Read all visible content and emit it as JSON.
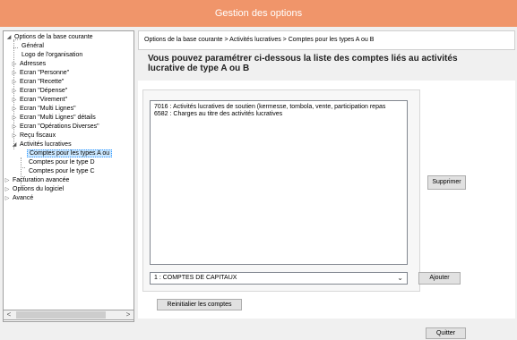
{
  "window": {
    "title": "Gestion des options"
  },
  "tree": {
    "items": [
      {
        "label": "Options de la base courante",
        "exp": "◢"
      },
      {
        "label": "Général",
        "exp": ""
      },
      {
        "label": "Logo de l'organisation",
        "exp": ""
      },
      {
        "label": "Adresses",
        "exp": "▷"
      },
      {
        "label": "Ecran \"Personne\"",
        "exp": "▷"
      },
      {
        "label": "Ecran \"Recette\"",
        "exp": "▷"
      },
      {
        "label": "Ecran \"Dépense\"",
        "exp": "▷"
      },
      {
        "label": "Ecran \"Virement\"",
        "exp": "▷"
      },
      {
        "label": "Ecran \"Multi Lignes\"",
        "exp": "▷"
      },
      {
        "label": "Ecran \"Multi Lignes\" détails",
        "exp": "▷"
      },
      {
        "label": "Ecran \"Opérations Diverses\"",
        "exp": "▷"
      },
      {
        "label": "Reçu fiscaux",
        "exp": "▷"
      },
      {
        "label": "Activités lucratives",
        "exp": "◢"
      },
      {
        "label": "Comptes pour les types A ou",
        "exp": ""
      },
      {
        "label": "Comptes pour le type D",
        "exp": ""
      },
      {
        "label": "Comptes pour le type C",
        "exp": ""
      },
      {
        "label": "Facturation avancée",
        "exp": "▷"
      },
      {
        "label": "Options du logiciel",
        "exp": "▷"
      },
      {
        "label": "Avancé",
        "exp": "▷"
      }
    ],
    "scroll_left": "<",
    "scroll_right": ">"
  },
  "breadcrumb": "Options de la base courante > Activités lucratives > Comptes pour les types A ou B",
  "heading": "Vous pouvez paramétrer ci-dessous la liste des comptes liés au activités lucrative de type A ou B",
  "list": {
    "items": [
      "7016 : Activités lucratives de soutien (kermesse, tombola, vente, participation repas",
      "6582 : Charges au titre des activités lucratives"
    ]
  },
  "select": {
    "value": "1 : COMPTES DE CAPITAUX",
    "chevron": "⌄"
  },
  "buttons": {
    "supprimer": "Supprimer",
    "ajouter": "Ajouter",
    "reinit": "Reinitialier les comptes",
    "quitter": "Quitter"
  }
}
